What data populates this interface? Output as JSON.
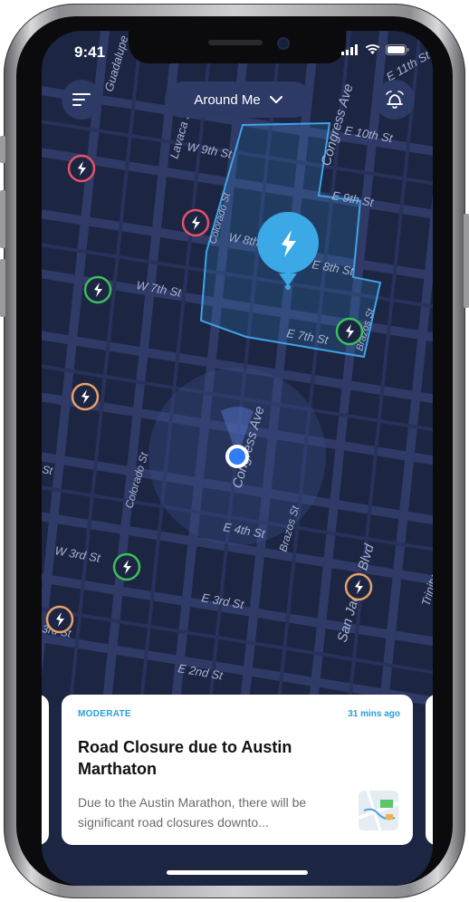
{
  "status_bar": {
    "time": "9:41"
  },
  "header": {
    "menu_icon": "hamburger-menu-icon",
    "location_filter": {
      "label": "Around Me",
      "icon": "chevron-down-icon"
    },
    "alerts_icon": "alarm-clock-icon"
  },
  "map": {
    "street_labels": [
      "Guadalupe",
      "Lavaca St",
      "W 9th St",
      "Colorado St",
      "W 8th St",
      "W 7th St",
      "Congress Ave",
      "E 10th St",
      "E 9th St",
      "E 8th St",
      "E 7th St",
      "Brazos St",
      "E 11th St",
      "Congress Ave",
      "Colorado St",
      "E 4th St",
      "Brazos St",
      "W 3rd St",
      "E 3rd St",
      "San Jacinto Blvd",
      "E 2nd St",
      "Trinity",
      "St",
      "3rd St"
    ],
    "colors": {
      "background": "#1c2542",
      "road": "#2f3a66",
      "zone_outline": "#3fa3e8",
      "marker_red": "#e2526a",
      "marker_green": "#3cbf5c",
      "marker_orange": "#e7a16a",
      "marker_blue": "#3ba9e6",
      "user_dot": "#2f7cf6"
    }
  },
  "incident_card": {
    "severity": "MODERATE",
    "time_ago": "31 mins ago",
    "title": "Road Closure due to Austin Marthaton",
    "description": "Due to the Austin Marathon, there will be significant road closures downto...",
    "thumbnail_icon": "map-thumbnail-icon"
  }
}
